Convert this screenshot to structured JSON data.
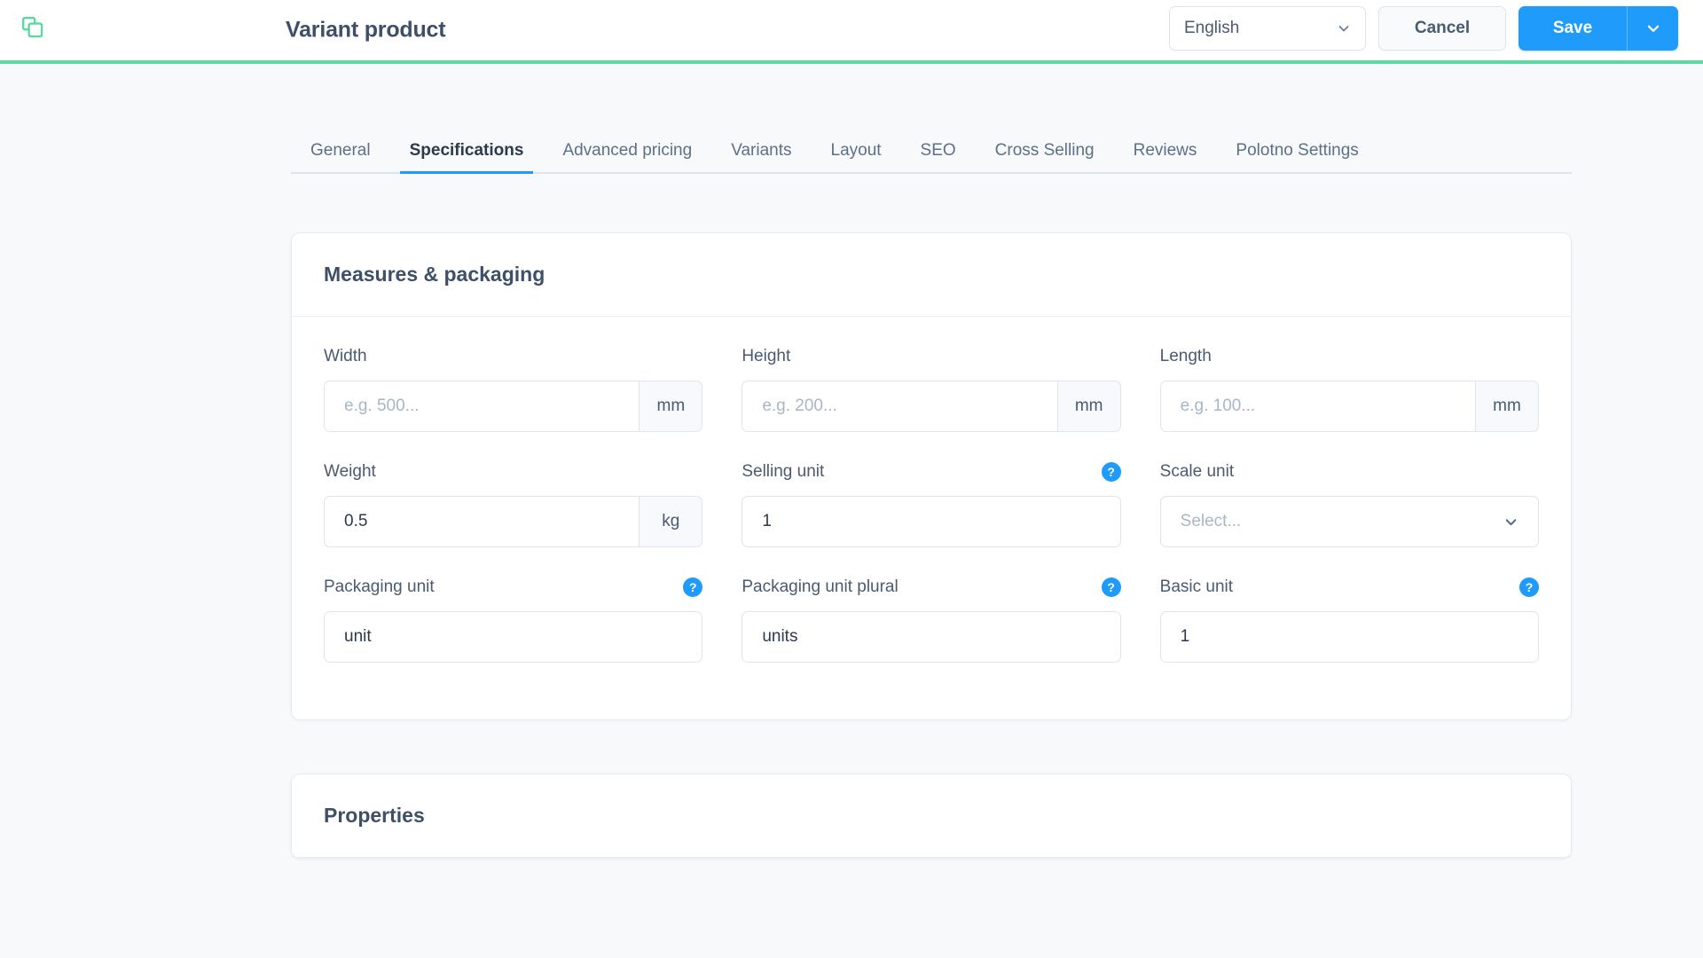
{
  "header": {
    "brand_icon": "copy-duplicate-icon",
    "title": "Variant product",
    "language": {
      "value": "English",
      "chevron_icon": "chevron-down-icon"
    },
    "cancel_label": "Cancel",
    "save_label": "Save",
    "save_caret_icon": "chevron-down-icon",
    "accent_color": "#1f9bfb",
    "border_accent_color": "#5ad9a2"
  },
  "tabs": {
    "active": "Specifications",
    "items": [
      {
        "label": "General",
        "active": false
      },
      {
        "label": "Specifications",
        "active": true
      },
      {
        "label": "Advanced pricing",
        "active": false
      },
      {
        "label": "Variants",
        "active": false
      },
      {
        "label": "Layout",
        "active": false
      },
      {
        "label": "SEO",
        "active": false
      },
      {
        "label": "Cross Selling",
        "active": false
      },
      {
        "label": "Reviews",
        "active": false
      },
      {
        "label": "Polotno Settings",
        "active": false
      }
    ]
  },
  "measures_card": {
    "title": "Measures & packaging",
    "fields": {
      "width": {
        "label": "Width",
        "value": "",
        "placeholder": "e.g. 500...",
        "addon": "mm",
        "help": false
      },
      "height": {
        "label": "Height",
        "value": "",
        "placeholder": "e.g. 200...",
        "addon": "mm",
        "help": false
      },
      "length": {
        "label": "Length",
        "value": "",
        "placeholder": "e.g. 100...",
        "addon": "mm",
        "help": false
      },
      "weight": {
        "label": "Weight",
        "value": "0.5",
        "placeholder": "",
        "addon": "kg",
        "help": false
      },
      "selling_unit": {
        "label": "Selling unit",
        "value": "1",
        "placeholder": "",
        "addon": null,
        "help": true,
        "help_icon": "question-mark-icon"
      },
      "scale_unit": {
        "label": "Scale unit",
        "value": "",
        "placeholder": "Select...",
        "addon": null,
        "help": false,
        "chevron_icon": "chevron-down-icon"
      },
      "packaging_unit": {
        "label": "Packaging unit",
        "value": "unit",
        "placeholder": "",
        "addon": null,
        "help": true,
        "help_icon": "question-mark-icon"
      },
      "packaging_unit_plural": {
        "label": "Packaging unit plural",
        "value": "units",
        "placeholder": "",
        "addon": null,
        "help": true,
        "help_icon": "question-mark-icon"
      },
      "basic_unit": {
        "label": "Basic unit",
        "value": "1",
        "placeholder": "",
        "addon": null,
        "help": true,
        "help_icon": "question-mark-icon"
      }
    }
  },
  "properties_card": {
    "title": "Properties"
  }
}
